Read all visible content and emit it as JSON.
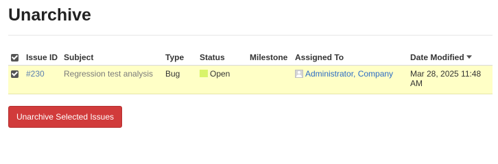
{
  "page": {
    "title": "Unarchive"
  },
  "table": {
    "headers": {
      "issue_id": "Issue ID",
      "subject": "Subject",
      "type": "Type",
      "status": "Status",
      "milestone": "Milestone",
      "assigned_to": "Assigned To",
      "date_modified": "Date Modified"
    },
    "sort": {
      "column": "Date Modified",
      "direction": "descending",
      "icon": "sort-down-arrow-icon"
    },
    "select_all_checked": true,
    "rows": [
      {
        "checked": true,
        "issue_id": "#230",
        "subject": "Regression test analysis",
        "type": "Bug",
        "status": "Open",
        "status_color": "#d9f46a",
        "milestone": "",
        "assigned_to": "Administrator, Company",
        "date_modified": "Mar 28, 2025 11:48 AM"
      }
    ],
    "row_highlight_color": "#ffffc6"
  },
  "actions": {
    "unarchive_label": "Unarchive Selected Issues",
    "unarchive_color": "#d13b3b"
  }
}
